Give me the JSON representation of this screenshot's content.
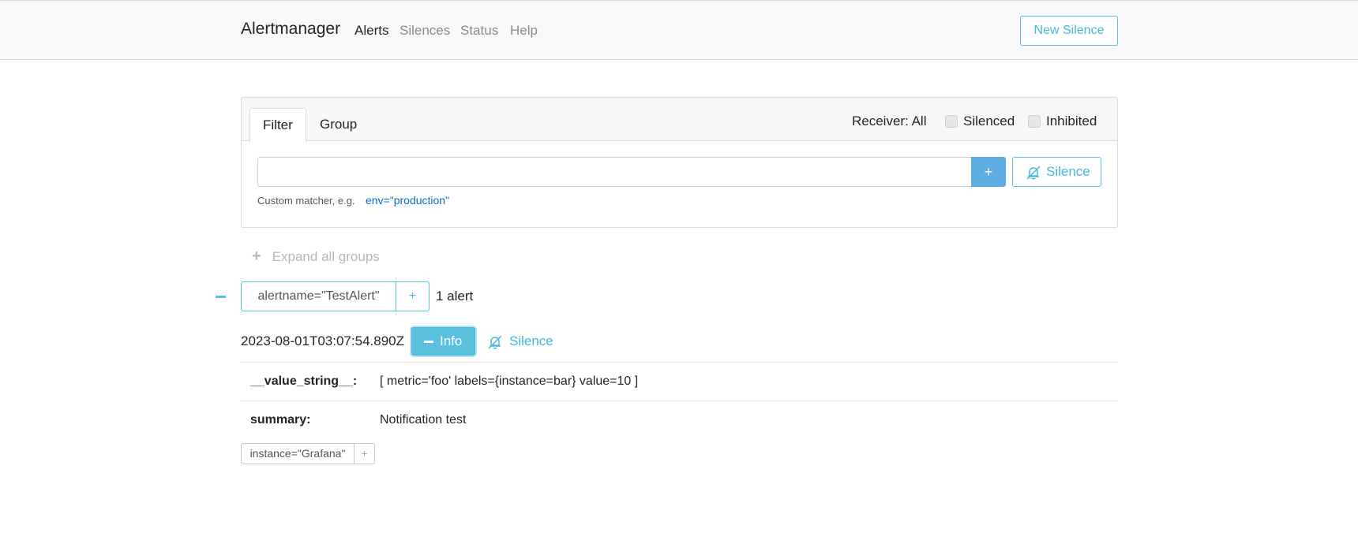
{
  "navbar": {
    "brand": "Alertmanager",
    "links": [
      {
        "label": "Alerts",
        "active": true
      },
      {
        "label": "Silences",
        "active": false
      },
      {
        "label": "Status",
        "active": false
      },
      {
        "label": "Help",
        "active": false
      }
    ],
    "new_silence_label": "New Silence"
  },
  "filter_panel": {
    "tabs": [
      {
        "label": "Filter",
        "active": true
      },
      {
        "label": "Group",
        "active": false
      }
    ],
    "receiver_label": "Receiver: All",
    "silenced_label": "Silenced",
    "inhibited_label": "Inhibited",
    "matcher_value": "",
    "add_button_label": "+",
    "silence_button_label": "Silence",
    "hint_text": "Custom matcher, e.g.",
    "hint_example": "env=\"production\""
  },
  "expand_all": {
    "icon": "+",
    "label": "Expand all groups"
  },
  "group": {
    "label": "alertname=\"TestAlert\"",
    "plus_label": "+",
    "count": "1 alert"
  },
  "alert": {
    "timestamp": "2023-08-01T03:07:54.890Z",
    "info_label": "Info",
    "silence_label": "Silence",
    "annotations": [
      {
        "key": "__value_string__:",
        "value": "[ metric='foo' labels={instance=bar} value=10 ]"
      },
      {
        "key": "summary:",
        "value": "Notification test"
      }
    ],
    "labels": [
      {
        "text": "instance=\"Grafana\"",
        "plus": "+"
      }
    ]
  },
  "colors": {
    "accent": "#5bc0de",
    "primary_button": "#5dade2",
    "link": "#0b6cc9",
    "navbar_bg": "#f8f8f8"
  },
  "icons": {
    "silence": "bell-slash-icon",
    "collapse": "minus-icon",
    "expand": "plus-icon"
  }
}
